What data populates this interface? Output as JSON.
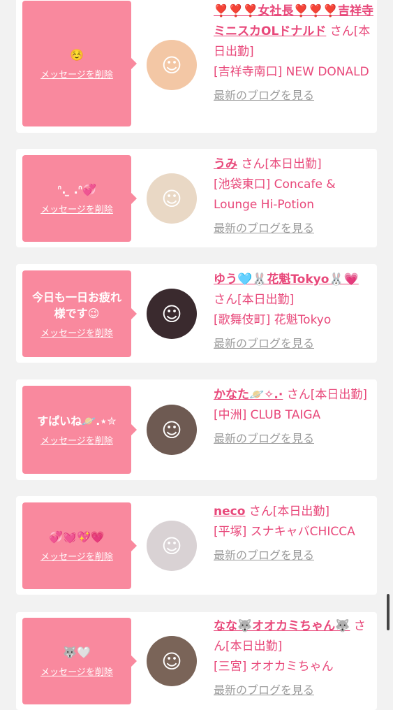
{
  "cards": [
    {
      "message": "☺️",
      "delete_label": "メッセージを削除",
      "name": "❣️❣️❣️女社長❣️❣️❣️吉祥寺ミニスカOLドナルド",
      "san": "さん",
      "status": "[本日出勤]",
      "shop": "[吉祥寺南口] NEW DONALD",
      "blog_link": "最新のブログを見る",
      "avatar_icon": "anime-girl-avatar",
      "avatar_color": "#f3c7a5"
    },
    {
      "message": "ᐢ. ̫ .ᐢ💞",
      "delete_label": "メッセージを削除",
      "name": "うみ",
      "san": "さん",
      "status": "[本日出勤]",
      "shop": "[池袋東口] Concafe & Lounge Hi-Potion",
      "blog_link": "最新のブログを見る",
      "avatar_icon": "blonde-girl-avatar",
      "avatar_color": "#e9d8c5"
    },
    {
      "message": "今日も一日お疲れ様です😉",
      "delete_label": "メッセージを削除",
      "name": "ゆう🩵🐰花魁Tokyo🐰💗",
      "san": "さん",
      "status": "[本日出勤]",
      "shop": "[歌舞伎町] 花魁Tokyo",
      "blog_link": "最新のブログを見る",
      "avatar_icon": "dark-hair-girl-avatar",
      "avatar_color": "#3a2a2e"
    },
    {
      "message": "すぱいね🪐.⋆✮",
      "delete_label": "メッセージを削除",
      "name": "かなた🪐✧.·",
      "san": "さん",
      "status": "[本日出勤]",
      "shop": "[中洲] CLUB TAIGA",
      "blog_link": "最新のブログを見る",
      "avatar_icon": "long-hair-girl-avatar",
      "avatar_color": "#6e5a52"
    },
    {
      "message": "💞💓💖💗",
      "delete_label": "メッセージを削除",
      "name": "neco",
      "san": "さん",
      "status": "[本日出勤]",
      "shop": "[平塚] スナキャバCHICCA",
      "blog_link": "最新のブログを見る",
      "avatar_icon": "masked-girl-avatar",
      "avatar_color": "#d9d2d4"
    },
    {
      "message": "🐺🤍",
      "delete_label": "メッセージを削除",
      "name": "なな🐺オオカミちゃん🐺",
      "san": "さん",
      "status": "[本日出勤]",
      "shop": "[三宮] オオカミちゃん",
      "blog_link": "最新のブログを見る",
      "avatar_icon": "short-hair-girl-avatar",
      "avatar_color": "#7a6458"
    }
  ]
}
